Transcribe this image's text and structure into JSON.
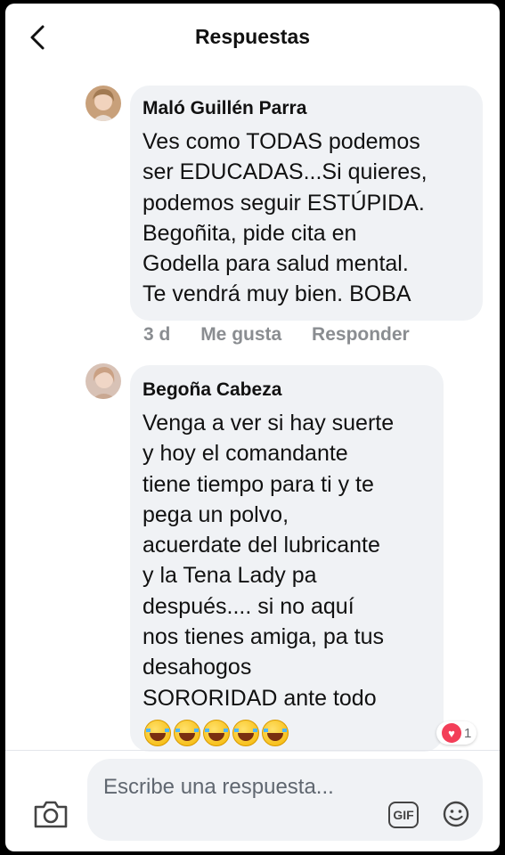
{
  "header": {
    "title": "Respuestas"
  },
  "comments": [
    {
      "author": "Maló Guillén Parra",
      "lines": [
        "Ves como TODAS podemos",
        "ser EDUCADAS...Si quieres,",
        "podemos seguir ESTÚPIDA.",
        "Begoñita, pide cita en",
        "Godella para  salud mental.",
        "Te vendrá muy bien. BOBA"
      ],
      "time": "3 d",
      "like_label": "Me gusta",
      "reply_label": "Responder"
    },
    {
      "author": "Begoña Cabeza",
      "lines": [
        "Venga a ver si hay suerte",
        "y hoy el comandante",
        "tiene tiempo para ti y te",
        "pega un polvo,",
        "acuerdate del lubricante",
        "y la Tena Lady pa",
        "después.... si no aquí",
        "nos tienes amiga, pa tus",
        "desahogos",
        "SORORIDAD ante todo"
      ],
      "emojis": [
        "😂",
        "😂",
        "😂",
        "😂",
        "😂"
      ],
      "reaction": {
        "icon": "heart",
        "count": "1"
      }
    }
  ],
  "composer": {
    "placeholder": "Escribe una respuesta...",
    "gif_label": "GIF"
  },
  "colors": {
    "bubble": "#f0f2f5",
    "meta": "#8a8d91",
    "heart": "#f33e58"
  }
}
